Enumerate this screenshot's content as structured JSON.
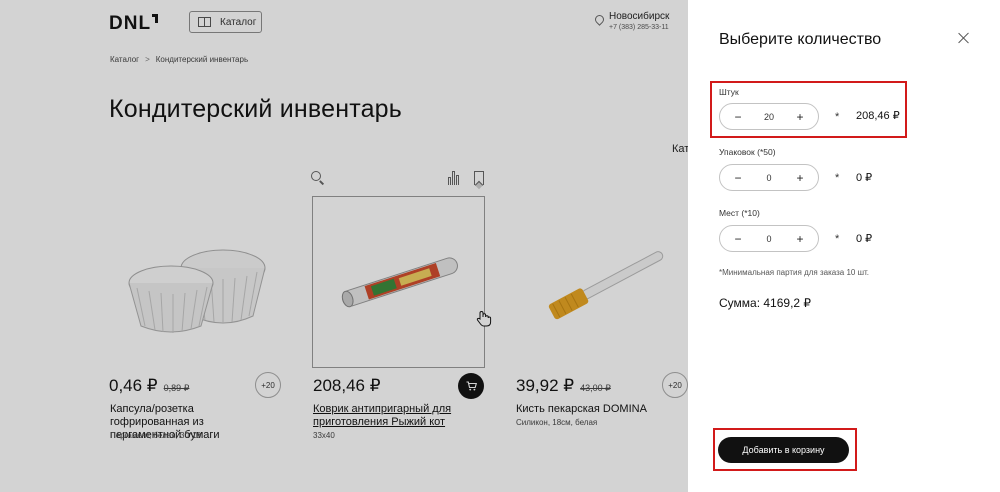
{
  "header": {
    "logo_text": "DNL",
    "catalog_label": "Каталог",
    "city": "Новосибирск",
    "phone": "+7 (383) 285-33-11"
  },
  "breadcrumb": {
    "root": "Каталог",
    "separator": ">",
    "current": "Кондитерский инвентарь"
  },
  "page_title": "Кондитерский инвентарь",
  "cut_text": "Кат",
  "products": [
    {
      "price": "0,46 ₽",
      "old_price": "0,89 ₽",
      "action": "+20",
      "name": "Капсула/розетка гофрированная из пергаментной бумаги",
      "desc": "Пергамент, белая, 30*18"
    },
    {
      "price": "208,46 ₽",
      "old_price": "",
      "action": "cart",
      "name": "Коврик антипригарный для приготовления Рыжий кот",
      "desc": "33x40"
    },
    {
      "price": "39,92 ₽",
      "old_price": "43,00 ₽",
      "action": "+20",
      "name": "Кисть пекарская DOMINA",
      "desc": "Силикон, 18см, белая"
    }
  ],
  "panel": {
    "title": "Выберите количество",
    "rows": [
      {
        "label": "Штук",
        "value": "20",
        "total": "208,46 ₽"
      },
      {
        "label": "Упаковок (*50)",
        "value": "0",
        "total": "0 ₽"
      },
      {
        "label": "Мест (*10)",
        "value": "0",
        "total": "0 ₽"
      }
    ],
    "minus": "−",
    "plus": "+",
    "times": "*",
    "note": "*Минимальная партия для заказа 10 шт.",
    "sum": "Сумма: 4169,2 ₽",
    "add_button": "Добавить в корзину"
  },
  "colors": {
    "highlight": "#d21a1a",
    "button_bg": "#111111",
    "overlay": "rgba(20,20,20,0.19)"
  }
}
